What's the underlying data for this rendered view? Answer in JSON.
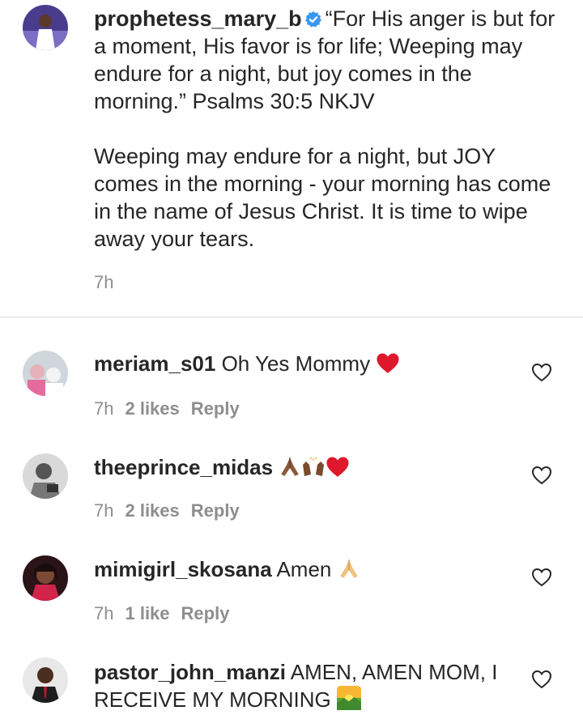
{
  "post": {
    "username": "prophetess_mary_b",
    "text_p1": "“For His anger is but for a moment, His favor is for life; Weeping may endure for a night, but joy comes in the morning.” Psalms 30:5 NKJV",
    "text_p2": "Weeping may endure for a night, but JOY comes in the morning - your morning has come in the name of Jesus Christ. It is time to wipe away your tears.",
    "time": "7h",
    "verified_color": "#3897f0"
  },
  "comments": [
    {
      "username": "meriam_s01",
      "text": "Oh Yes Mommy",
      "emojis": [
        "red-heart"
      ],
      "time": "7h",
      "likes": "2 likes",
      "reply": "Reply"
    },
    {
      "username": "theeprince_midas",
      "text": "",
      "emojis": [
        "praying-hands",
        "raising-hands",
        "red-heart"
      ],
      "time": "7h",
      "likes": "2 likes",
      "reply": "Reply"
    },
    {
      "username": "mimigirl_skosana",
      "text": "Amen",
      "emojis": [
        "praying-hands"
      ],
      "time": "7h",
      "likes": "1 like",
      "reply": "Reply"
    },
    {
      "username": "pastor_john_manzi",
      "text": "AMEN, AMEN MOM, I RECEIVE MY MORNING",
      "emojis": [
        "sunrise"
      ],
      "time": "",
      "likes": "",
      "reply": ""
    }
  ]
}
